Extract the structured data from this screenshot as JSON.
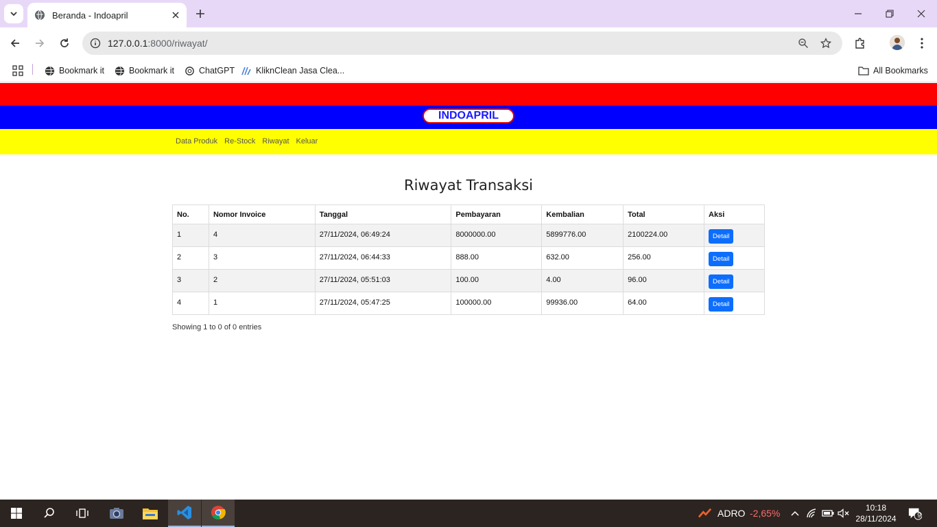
{
  "browser": {
    "tab_title": "Beranda - Indoapril",
    "url_host": "127.0.0.1",
    "url_path": ":8000/riwayat/",
    "bookmarks": [
      {
        "label": "Bookmark it",
        "icon": "globe-icon"
      },
      {
        "label": "Bookmark it",
        "icon": "globe-icon"
      },
      {
        "label": "ChatGPT",
        "icon": "openai-icon"
      },
      {
        "label": "KliknClean Jasa Clea...",
        "icon": "site-icon"
      }
    ],
    "all_bookmarks": "All Bookmarks"
  },
  "site": {
    "brand": "INDOAPRIL",
    "menu": [
      "Data Produk",
      "Re-Stock",
      "Riwayat",
      "Keluar"
    ],
    "colors": {
      "red": "#ff0000",
      "blue": "#0000ff",
      "yellow": "#ffff00",
      "button": "#0d6efd"
    }
  },
  "main": {
    "title": "Riwayat Transaksi",
    "columns": [
      "No.",
      "Nomor Invoice",
      "Tanggal",
      "Pembayaran",
      "Kembalian",
      "Total",
      "Aksi"
    ],
    "rows": [
      {
        "no": "1",
        "invoice": "4",
        "tanggal": "27/11/2024, 06:49:24",
        "pembayaran": "8000000.00",
        "kembalian": "5899776.00",
        "total": "2100224.00",
        "aksi": "Detail"
      },
      {
        "no": "2",
        "invoice": "3",
        "tanggal": "27/11/2024, 06:44:33",
        "pembayaran": "888.00",
        "kembalian": "632.00",
        "total": "256.00",
        "aksi": "Detail"
      },
      {
        "no": "3",
        "invoice": "2",
        "tanggal": "27/11/2024, 05:51:03",
        "pembayaran": "100.00",
        "kembalian": "4.00",
        "total": "96.00",
        "aksi": "Detail"
      },
      {
        "no": "4",
        "invoice": "1",
        "tanggal": "27/11/2024, 05:47:25",
        "pembayaran": "100000.00",
        "kembalian": "99936.00",
        "total": "64.00",
        "aksi": "Detail"
      }
    ],
    "showing": "Showing 1 to 0 of 0 entries"
  },
  "taskbar": {
    "ticker": "ADRO",
    "ticker_change": "-2,65%",
    "time": "10:18",
    "date": "28/11/2024",
    "notifications": "9"
  }
}
